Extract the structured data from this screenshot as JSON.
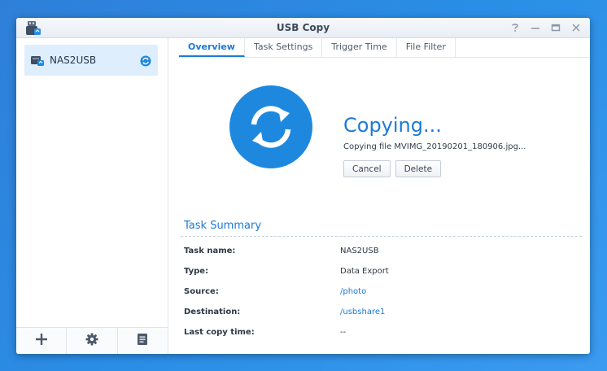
{
  "window": {
    "title": "USB Copy"
  },
  "sidebar": {
    "tasks": [
      {
        "label": "NAS2USB"
      }
    ]
  },
  "tabs": [
    {
      "label": "Overview"
    },
    {
      "label": "Task Settings"
    },
    {
      "label": "Trigger Time"
    },
    {
      "label": "File Filter"
    }
  ],
  "status": {
    "title": "Copying...",
    "detail": "Copying file MVIMG_20190201_180906.jpg..."
  },
  "buttons": {
    "cancel": "Cancel",
    "delete": "Delete"
  },
  "summary": {
    "title": "Task Summary",
    "rows": [
      {
        "label": "Task name:",
        "value": "NAS2USB"
      },
      {
        "label": "Type:",
        "value": "Data Export"
      },
      {
        "label": "Source:",
        "value": "/photo"
      },
      {
        "label": "Destination:",
        "value": "/usbshare1"
      },
      {
        "label": "Last copy time:",
        "value": "--"
      }
    ]
  },
  "colors": {
    "accent": "#1c7ad8",
    "selected_bg": "#dfeefc",
    "desktop": "#2a8ee6"
  },
  "icons": {
    "app": "usb-copy-icon",
    "help": "help-icon",
    "minimize": "minimize-icon",
    "maximize": "maximize-icon",
    "close": "close-icon",
    "task": "usb-drive-icon",
    "task_status": "syncing-icon",
    "big_status": "sync-arrows-icon",
    "add": "plus-icon",
    "settings": "gear-icon",
    "log": "document-icon"
  }
}
